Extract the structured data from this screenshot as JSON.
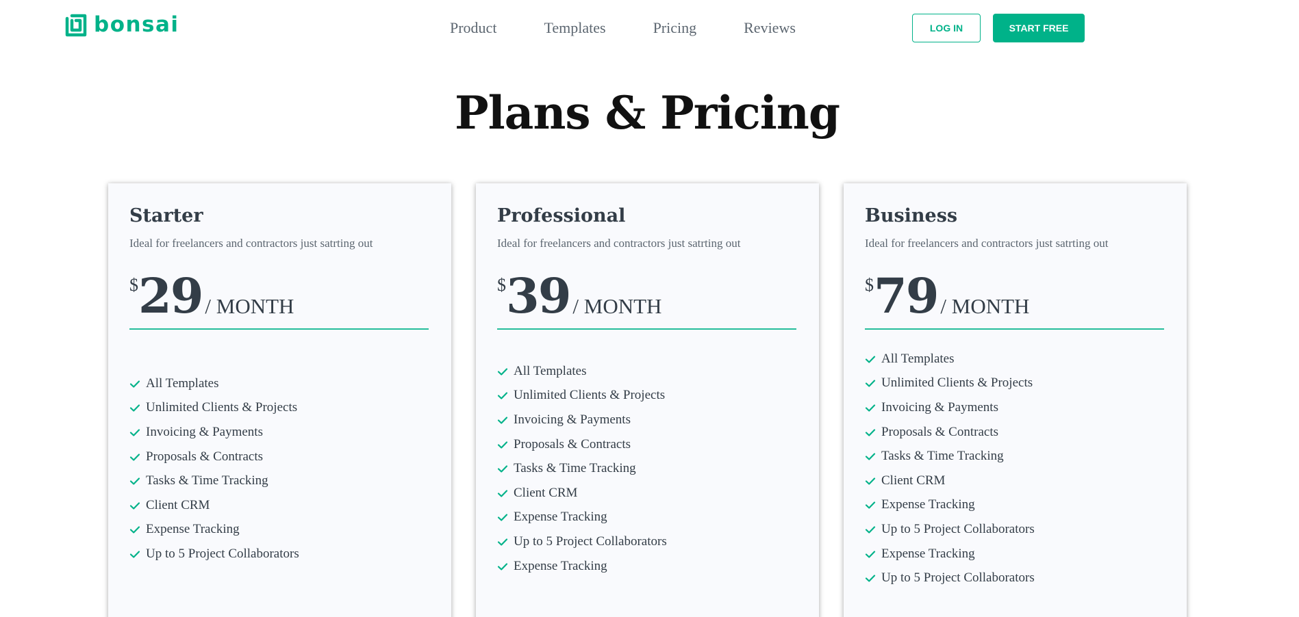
{
  "header": {
    "logo_text": "bonsai",
    "nav": [
      "Product",
      "Templates",
      "Pricing",
      "Reviews"
    ],
    "login_label": "LOG IN",
    "start_label": "START FREE"
  },
  "page_title": "Plans & Pricing",
  "colors": {
    "accent": "#00b289",
    "text_dark": "#333d47",
    "text_muted": "#5c6670",
    "card_bg": "#f9fafd"
  },
  "icons": [
    "bonsai-logo-icon",
    "check-icon"
  ],
  "plans": [
    {
      "name": "Starter",
      "description": "Ideal for freelancers and contractors just satrting out",
      "currency": "$",
      "price": "29",
      "period": "/ MONTH",
      "features": [
        "All Templates",
        "Unlimited Clients & Projects",
        "Invoicing & Payments",
        "Proposals & Contracts",
        "Tasks & Time Tracking",
        "Client CRM",
        "Expense Tracking",
        "Up to 5 Project Collaborators"
      ]
    },
    {
      "name": "Professional",
      "description": "Ideal for freelancers and contractors just satrting out",
      "currency": "$",
      "price": "39",
      "period": "/ MONTH",
      "features": [
        "All Templates",
        "Unlimited Clients & Projects",
        "Invoicing & Payments",
        "Proposals & Contracts",
        "Tasks & Time Tracking",
        "Client CRM",
        "Expense Tracking",
        "Up to 5 Project Collaborators",
        "Expense Tracking"
      ]
    },
    {
      "name": "Business",
      "description": "Ideal for freelancers and contractors just satrting out",
      "currency": "$",
      "price": "79",
      "period": "/ MONTH",
      "features": [
        "All Templates",
        "Unlimited Clients & Projects",
        "Invoicing & Payments",
        "Proposals & Contracts",
        "Tasks & Time Tracking",
        "Client CRM",
        "Expense Tracking",
        "Up to 5 Project Collaborators",
        "Expense Tracking",
        "Up to 5 Project Collaborators"
      ]
    }
  ]
}
